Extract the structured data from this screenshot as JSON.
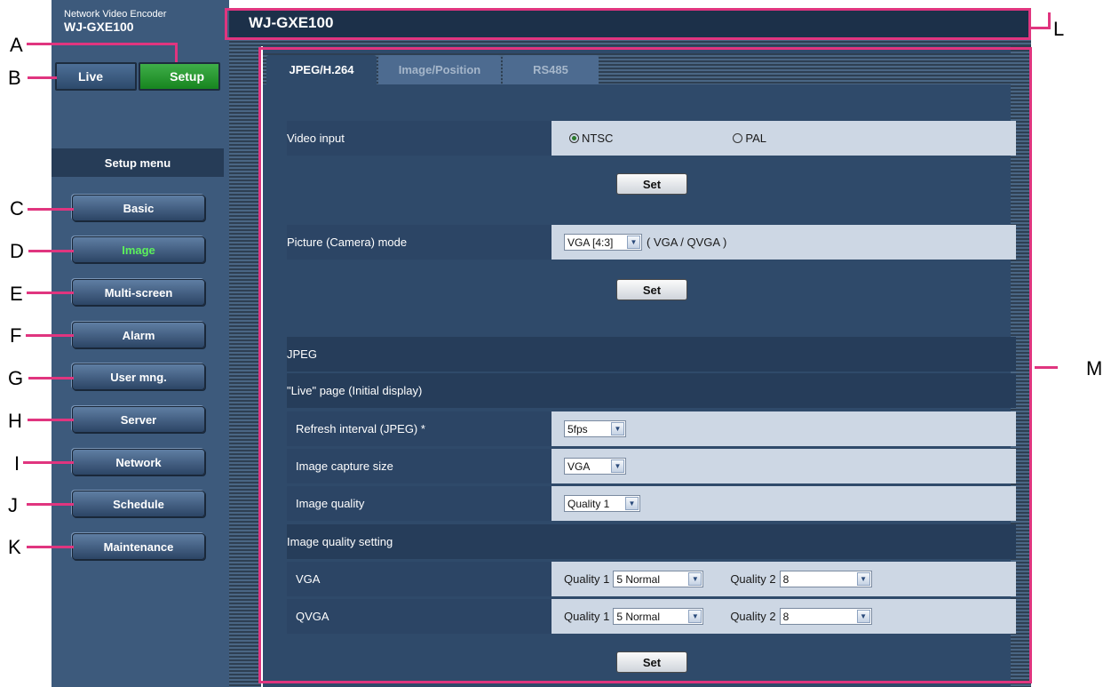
{
  "brand": {
    "product_name": "Network Video Encoder",
    "model": "WJ-GXE100"
  },
  "header": {
    "title": "WJ-GXE100"
  },
  "mode_buttons": {
    "live": "Live",
    "setup": "Setup"
  },
  "setup_menu": {
    "title": "Setup menu",
    "items": [
      "Basic",
      "Image",
      "Multi-screen",
      "Alarm",
      "User mng.",
      "Server",
      "Network",
      "Schedule",
      "Maintenance"
    ],
    "active": "Image"
  },
  "tabs": [
    "JPEG/H.264",
    "Image/Position",
    "RS485"
  ],
  "video_input": {
    "label": "Video input",
    "options": [
      "NTSC",
      "PAL"
    ],
    "selected": "NTSC"
  },
  "picture_mode": {
    "label": "Picture (Camera) mode",
    "value": "VGA [4:3]",
    "note": "( VGA / QVGA )"
  },
  "set_label": "Set",
  "jpeg": {
    "section": "JPEG",
    "live_section": "\"Live\" page (Initial display)",
    "refresh_label": "Refresh interval (JPEG) *",
    "refresh_value": "5fps",
    "capture_label": "Image capture size",
    "capture_value": "VGA",
    "quality_label": "Image quality",
    "quality_value": "Quality 1",
    "quality_setting_section": "Image quality setting",
    "vga": {
      "label": "VGA",
      "q1_label": "Quality 1",
      "q1_value": "5 Normal",
      "q2_label": "Quality 2",
      "q2_value": "8"
    },
    "qvga": {
      "label": "QVGA",
      "q1_label": "Quality 1",
      "q1_value": "5 Normal",
      "q2_label": "Quality 2",
      "q2_value": "8"
    }
  },
  "annotations": {
    "A": "A",
    "B": "B",
    "C": "C",
    "D": "D",
    "E": "E",
    "F": "F",
    "G": "G",
    "H": "H",
    "I": "I",
    "J": "J",
    "K": "K",
    "L": "L",
    "M": "M"
  },
  "colors": {
    "accent": "#e0357f",
    "panel": "#3d5a7c",
    "active_menu": "#5cf05c",
    "setup_button": "#17851f"
  }
}
